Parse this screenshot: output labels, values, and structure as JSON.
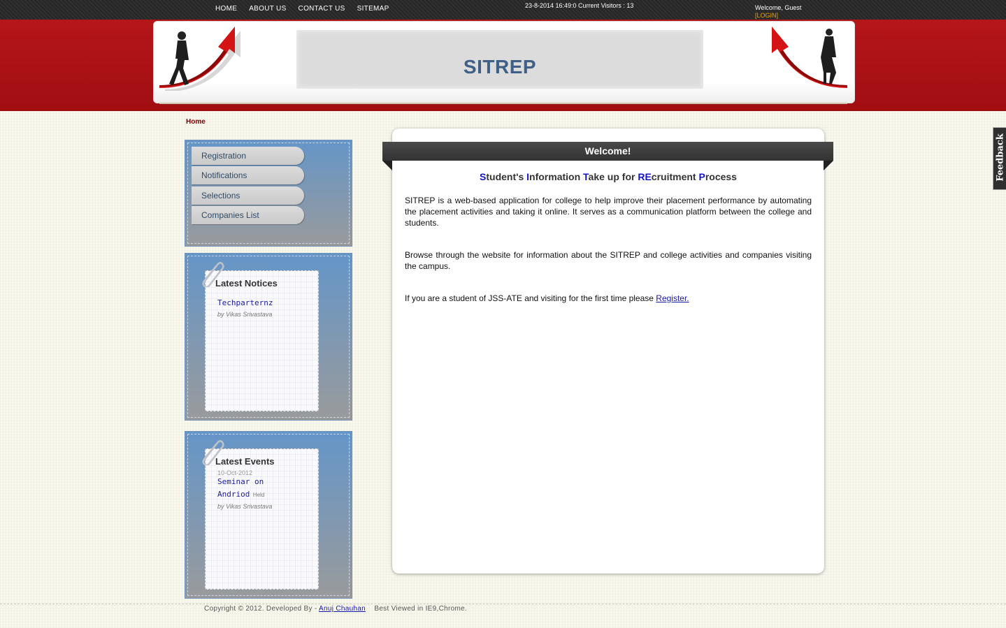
{
  "topnav": {
    "items": [
      "HOME",
      "ABOUT US",
      "CONTACT US",
      "SITEMAP"
    ],
    "visitors": "23-8-2014 16:49:0 Current Visitors : 13",
    "welcome": "Welcome, Guest",
    "login": "[LOGIN]"
  },
  "header": {
    "title": "SITREP"
  },
  "breadcrumb": "Home",
  "sidebar": {
    "menu": [
      "Registration",
      "Notifications",
      "Selections",
      "Companies List"
    ],
    "notices": {
      "title": "Latest Notices",
      "items": [
        {
          "title": "Techparternz",
          "by": "by Vikas Srivastava"
        }
      ]
    },
    "events": {
      "title": "Latest Events",
      "items": [
        {
          "date": "10-Oct-2012",
          "title_line1": "Seminar on",
          "title_line2": "Andriod",
          "status": "Held",
          "by": "by Vikas Srivastava"
        }
      ]
    }
  },
  "main": {
    "ribbon": "Welcome!",
    "subtitle": {
      "parts": [
        {
          "cap": "S",
          "rest": "tudent's "
        },
        {
          "cap": "I",
          "rest": "nformation "
        },
        {
          "cap": "T",
          "rest": "ake up for "
        },
        {
          "cap": "RE",
          "rest": "cruitment "
        },
        {
          "cap": "P",
          "rest": "rocess"
        }
      ]
    },
    "para1": "SITREP is a web-based application for college to help improve their placement performance by automating the placement activities and taking it online. It serves as a communication platform between the college and students.",
    "para2": "Browse through the website for information about the SITREP and college activities and companies visiting the campus.",
    "para3": "If you are a student of JSS-ATE and visiting for the first time please ",
    "register_link": "Register."
  },
  "feedback": "Feedback",
  "footer": {
    "copyright": "Copyright © 2012. Developed By - ",
    "author": "Anuj Chauhan",
    "best_viewed": "Best Viewed in IE9,Chrome."
  },
  "colors": {
    "brand_red": "#b5161a",
    "title_blue": "#3f5f87",
    "panel_blue": "#6596c8"
  }
}
